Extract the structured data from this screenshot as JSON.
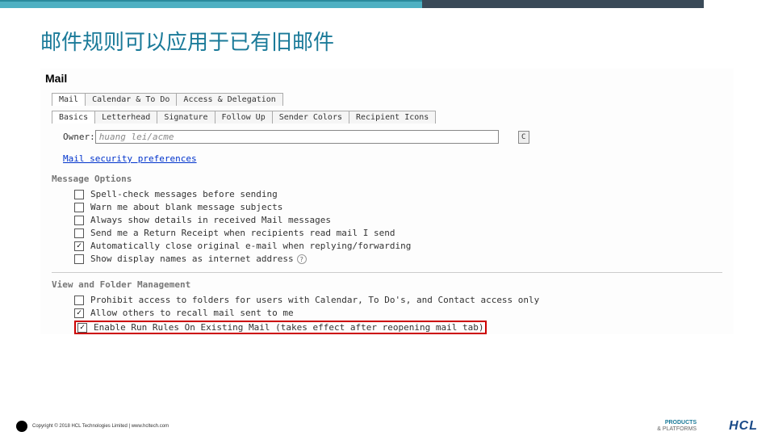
{
  "slide": {
    "title": "邮件规则可以应用于已有旧邮件"
  },
  "panel": {
    "header": "Mail",
    "main_tabs": [
      {
        "label": "Mail",
        "active": true
      },
      {
        "label": "Calendar & To Do",
        "active": false
      },
      {
        "label": "Access & Delegation",
        "active": false
      }
    ],
    "sub_tabs": [
      {
        "label": "Basics",
        "active": true
      },
      {
        "label": "Letterhead",
        "active": false
      },
      {
        "label": "Signature",
        "active": false
      },
      {
        "label": "Follow Up",
        "active": false
      },
      {
        "label": "Sender Colors",
        "active": false
      },
      {
        "label": "Recipient Icons",
        "active": false
      }
    ],
    "owner_label": "Owner:",
    "owner_value": "huang lei/acme",
    "owner_button": "C",
    "security_link": "Mail security preferences",
    "message_options_header": "Message Options",
    "message_options": [
      {
        "checked": false,
        "label": "Spell-check messages before sending"
      },
      {
        "checked": false,
        "label": "Warn me about blank message subjects"
      },
      {
        "checked": false,
        "label": "Always show details in received Mail messages"
      },
      {
        "checked": false,
        "label": "Send me a Return Receipt when recipients read mail I send"
      },
      {
        "checked": true,
        "label": "Automatically close original e-mail when replying/forwarding"
      },
      {
        "checked": false,
        "label": "Show display names as internet address",
        "help": true
      }
    ],
    "view_folder_header": "View and Folder Management",
    "view_folder_options": [
      {
        "checked": false,
        "label": "Prohibit access to folders for users with Calendar, To Do's, and Contact access only"
      },
      {
        "checked": true,
        "label": "Allow others to recall mail sent to me"
      },
      {
        "checked": true,
        "label": "Enable Run Rules On Existing Mail (takes effect after reopening mail tab)",
        "highlight": true
      }
    ]
  },
  "footer": {
    "copyright": "Copyright © 2018 HCL Technologies Limited  |  www.hcltech.com",
    "logo1_line1": "PRODUCTS",
    "logo1_line2": "& PLATFORMS",
    "logo2": "HCL"
  }
}
